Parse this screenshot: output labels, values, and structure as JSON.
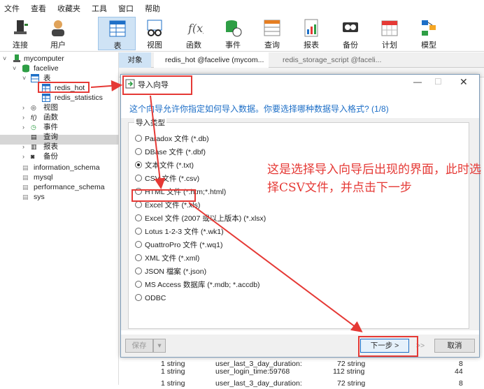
{
  "menu": [
    "文件",
    "查看",
    "收藏夹",
    "工具",
    "窗口",
    "帮助"
  ],
  "toolbar": [
    {
      "label": "连接",
      "icon": "connection-icon"
    },
    {
      "label": "用户",
      "icon": "user-icon"
    },
    {
      "label": "表",
      "icon": "table-icon",
      "active": true
    },
    {
      "label": "视图",
      "icon": "view-icon"
    },
    {
      "label": "函数",
      "icon": "function-icon"
    },
    {
      "label": "事件",
      "icon": "event-icon"
    },
    {
      "label": "查询",
      "icon": "query-icon"
    },
    {
      "label": "报表",
      "icon": "report-icon"
    },
    {
      "label": "备份",
      "icon": "backup-icon"
    },
    {
      "label": "计划",
      "icon": "schedule-icon"
    },
    {
      "label": "模型",
      "icon": "model-icon"
    }
  ],
  "tree": {
    "connection": "mycomputer",
    "database": "facelive",
    "tables_label": "表",
    "tables": [
      "redis_hot",
      "redis_statistics"
    ],
    "other_nodes": [
      "视图",
      "函数",
      "事件",
      "查询",
      "报表",
      "备份"
    ],
    "other_databases": [
      "information_schema",
      "mysql",
      "performance_schema",
      "sys"
    ]
  },
  "tabs": {
    "objects": "对象",
    "tab1": "redis_hot @facelive (mycom...",
    "tab2": "redis_storage_script @faceli..."
  },
  "background_rows": [
    {
      "a": "1 string",
      "b": "user_last_3_day_duration:",
      "c": "72 string",
      "d": "8"
    },
    {
      "a": "1 string",
      "b": "user_login_time:59768",
      "c": "112 string",
      "d": "44"
    },
    {
      "a": "1 string",
      "b": "user_last_3_day_duration:",
      "c": "72 string",
      "d": "8"
    }
  ],
  "dialog": {
    "title": "导入向导",
    "question": "这个向导允许你指定如何导入数据。你要选择哪种数据导入格式? (1/8)",
    "group_label": "导入类型",
    "options": [
      "Paradox 文件 (*.db)",
      "DBase 文件 (*.dbf)",
      "文本文件 (*.txt)",
      "CSV 文件 (*.csv)",
      "HTML 文件 (*.htm;*.html)",
      "Excel 文件 (*.xls)",
      "Excel 文件 (2007 或以上版本) (*.xlsx)",
      "Lotus 1-2-3 文件 (*.wk1)",
      "QuattroPro 文件 (*.wq1)",
      "XML 文件 (*.xml)",
      "JSON 檔案 (*.json)",
      "MS Access 数据库 (*.mdb; *.accdb)",
      "ODBC"
    ],
    "selected_option": "文本文件 (*.txt)",
    "save_button": "保存",
    "next_button": "下一步 >",
    "next_next_button": ">>",
    "cancel_button": "取消"
  },
  "annotation": "这是选择导入向导后出现的界面，此时选择CSV文件，并点击下一步",
  "colors": {
    "accent": "#1e6fc7",
    "annotation_red": "#e53935",
    "active_tab": "#cfe3f5"
  }
}
